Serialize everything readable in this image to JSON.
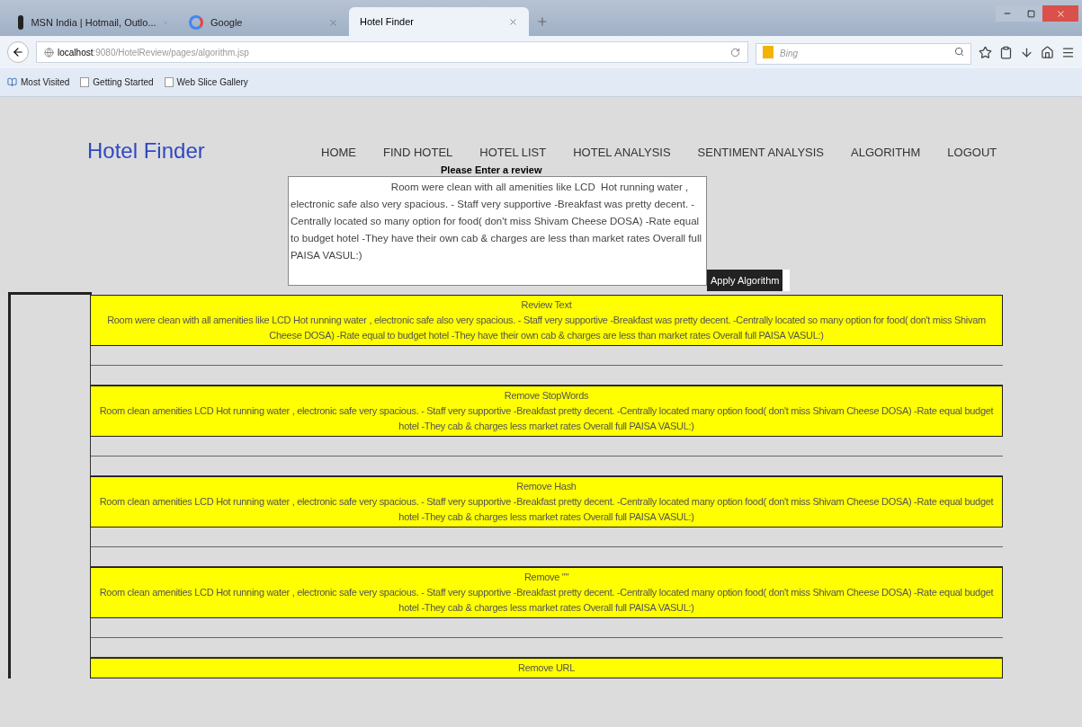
{
  "browser": {
    "tabs": [
      {
        "label": "MSN India | Hotmail, Outlo...",
        "selected": false,
        "kind": "msn"
      },
      {
        "label": "Google",
        "selected": false,
        "kind": "google"
      },
      {
        "label": "Hotel Finder",
        "selected": true,
        "kind": "plain"
      }
    ],
    "address": {
      "host": "localhost",
      "path": ":9080/HotelReview/pages/algorithm.jsp"
    },
    "search": {
      "placeholder": "Bing"
    },
    "bookmarks": [
      "Most Visited",
      "Getting Started",
      "Web Slice Gallery"
    ]
  },
  "site": {
    "logo": "Hotel Finder",
    "nav": [
      {
        "label": "HOME",
        "selected": false
      },
      {
        "label": "FIND HOTEL",
        "selected": false
      },
      {
        "label": "HOTEL LIST",
        "selected": false
      },
      {
        "label": "HOTEL ANALYSIS",
        "selected": false
      },
      {
        "label": "SENTIMENT ANALYSIS",
        "selected": false
      },
      {
        "label": "ALGORITHM",
        "selected": false
      },
      {
        "label": "LOGOUT",
        "selected": false
      }
    ],
    "review_label": "Please Enter a review",
    "review_value": "                                   Room were clean with all amenities like LCD  Hot running water , electronic safe also very spacious. - Staff very supportive -Breakfast was pretty decent. -Centrally located so many option for food( don't miss Shivam Cheese DOSA) -Rate equal to budget hotel -They have their own cab & charges are less than market rates Overall full PAISA VASUL:)",
    "apply_button": "Apply Algorithm",
    "steps": [
      {
        "title": "Review Text",
        "text": "Room were clean with all amenities like LCD Hot running water , electronic safe also very spacious. - Staff very supportive -Breakfast was pretty decent. -Centrally located so many option for food( don't miss Shivam Cheese DOSA) -Rate equal to budget hotel -They have their own cab & charges are less than market rates Overall full PAISA VASUL:)"
      },
      {
        "title": "Remove StopWords",
        "text": "Room clean amenities LCD Hot running water , electronic safe very spacious. - Staff very supportive -Breakfast pretty decent. -Centrally located many option food( don't miss Shivam Cheese DOSA) -Rate equal budget hotel -They cab & charges less market rates Overall full PAISA VASUL:)"
      },
      {
        "title": "Remove Hash",
        "text": "Room clean amenities LCD Hot running water , electronic safe very spacious. - Staff very supportive -Breakfast pretty decent. -Centrally located many option food( don't miss Shivam Cheese DOSA) -Rate equal budget hotel -They cab & charges less market rates Overall full PAISA VASUL:)"
      },
      {
        "title": "Remove \"\"",
        "text": "Room clean amenities LCD Hot running water , electronic safe very spacious. - Staff very supportive -Breakfast pretty decent. -Centrally located many option food( don't miss Shivam Cheese DOSA) -Rate equal budget hotel -They cab & charges less market rates Overall full PAISA VASUL:)"
      },
      {
        "title": "Remove URL"
      }
    ]
  }
}
